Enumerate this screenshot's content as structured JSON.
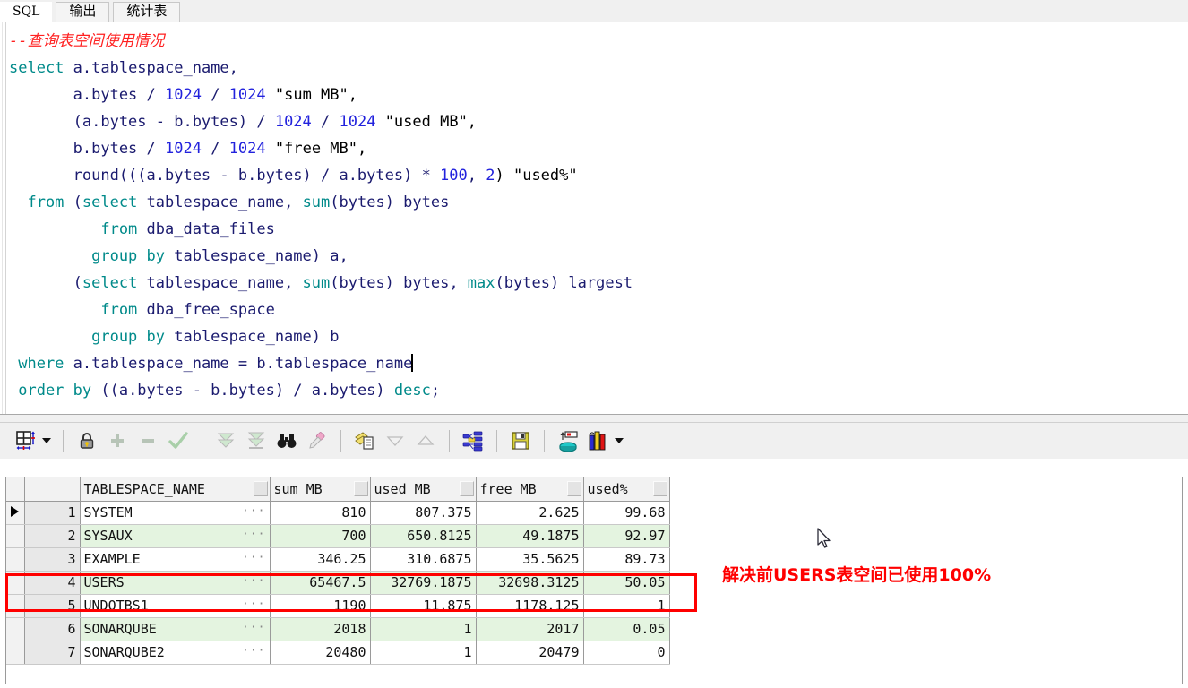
{
  "tabs": [
    {
      "label": "SQL",
      "active": true
    },
    {
      "label": "输出",
      "active": false
    },
    {
      "label": "统计表",
      "active": false
    }
  ],
  "editor": {
    "comment": "--查询表空间使用情况",
    "lines": [
      "select a.tablespace_name,",
      "       a.bytes / 1024 / 1024 \"sum MB\",",
      "       (a.bytes - b.bytes) / 1024 / 1024 \"used MB\",",
      "       b.bytes / 1024 / 1024 \"free MB\",",
      "       round(((a.bytes - b.bytes) / a.bytes) * 100, 2) \"used%\"",
      "  from (select tablespace_name, sum(bytes) bytes",
      "          from dba_data_files",
      "         group by tablespace_name) a,",
      "       (select tablespace_name, sum(bytes) bytes, max(bytes) largest",
      "          from dba_free_space",
      "         group by tablespace_name) b",
      " where a.tablespace_name = b.tablespace_name",
      " order by ((a.bytes - b.bytes) / a.bytes) desc;"
    ],
    "tokens": {
      "l1_kw": "select",
      "l1_rest": " a.tablespace_name,",
      "l2_id": "       a.bytes ",
      "l2_op1": "/ ",
      "l2_n1": "1024",
      "l2_op2": " / ",
      "l2_n2": "1024",
      "l2_str": " \"sum MB\",",
      "l3_a": "       (a.bytes - b.bytes) ",
      "l3_op": "/ ",
      "l3_n1": "1024",
      "l3_mid": " / ",
      "l3_n2": "1024",
      "l3_str": " \"used MB\",",
      "l4_a": "       b.bytes ",
      "l4_op": "/ ",
      "l4_n1": "1024",
      "l4_mid": " / ",
      "l4_n2": "1024",
      "l4_str": " \"free MB\",",
      "l5_a": "       round(((a.bytes - b.bytes) / a.bytes) * ",
      "l5_n1": "100",
      "l5_mid": ", ",
      "l5_n2": "2",
      "l5_str": ") \"used%\"",
      "l6_kw1": "  from ",
      "l6_p": "(",
      "l6_kw2": "select",
      "l6_id": " tablespace_name, ",
      "l6_kw3": "sum",
      "l6_rest": "(bytes) bytes",
      "l7_kw": "          from ",
      "l7_id": "dba_data_files",
      "l8_kw": "         group by ",
      "l8_id": "tablespace_name) a,",
      "l9_p": "       (",
      "l9_kw1": "select",
      "l9_id1": " tablespace_name, ",
      "l9_kw2": "sum",
      "l9_id2": "(bytes) bytes, ",
      "l9_kw3": "max",
      "l9_id3": "(bytes) largest",
      "l10_kw": "          from ",
      "l10_id": "dba_free_space",
      "l11_kw": "         group by ",
      "l11_id": "tablespace_name) b",
      "l12_kw": " where ",
      "l12_id": "a.tablespace_name = b.tablespace_name",
      "l13_kw1": " order by ",
      "l13_id": "((a.bytes - b.bytes) / a.bytes) ",
      "l13_kw2": "desc",
      "l13_end": ";"
    }
  },
  "toolbar": {
    "items": [
      {
        "name": "grid-layout-icon",
        "label": "Grid layout"
      },
      {
        "name": "lock-icon",
        "label": "Lock record"
      },
      {
        "name": "plus-icon",
        "label": "Insert record"
      },
      {
        "name": "minus-icon",
        "label": "Delete record"
      },
      {
        "name": "check-icon",
        "label": "Post edit"
      },
      {
        "name": "fetch-all-icon",
        "label": "Fetch all rows"
      },
      {
        "name": "fetch-last-icon",
        "label": "Fetch last page"
      },
      {
        "name": "binoculars-icon",
        "label": "Find"
      },
      {
        "name": "highlighter-icon",
        "label": "Highlight"
      },
      {
        "name": "copy-icon",
        "label": "Copy to clipboard"
      },
      {
        "name": "triangle-down-icon",
        "label": "Sort descending"
      },
      {
        "name": "triangle-up-icon",
        "label": "Sort ascending"
      },
      {
        "name": "hierarchy-icon",
        "label": "Explain plan"
      },
      {
        "name": "save-icon",
        "label": "Save"
      },
      {
        "name": "export-db-icon",
        "label": "Export data"
      },
      {
        "name": "chart-icon",
        "label": "Chart"
      }
    ]
  },
  "grid": {
    "columns": [
      "TABLESPACE_NAME",
      "sum MB",
      "used MB",
      "free MB",
      "used%"
    ],
    "rows": [
      {
        "n": "1",
        "name": "SYSTEM",
        "sum": "810",
        "used": "807.375",
        "free": "2.625",
        "pct": "99.68",
        "current": true
      },
      {
        "n": "2",
        "name": "SYSAUX",
        "sum": "700",
        "used": "650.8125",
        "free": "49.1875",
        "pct": "92.97",
        "current": false
      },
      {
        "n": "3",
        "name": "EXAMPLE",
        "sum": "346.25",
        "used": "310.6875",
        "free": "35.5625",
        "pct": "89.73",
        "current": false
      },
      {
        "n": "4",
        "name": "USERS",
        "sum": "65467.5",
        "used": "32769.1875",
        "free": "32698.3125",
        "pct": "50.05",
        "current": false
      },
      {
        "n": "5",
        "name": "UNDOTBS1",
        "sum": "1190",
        "used": "11.875",
        "free": "1178.125",
        "pct": "1",
        "current": false
      },
      {
        "n": "6",
        "name": "SONARQUBE",
        "sum": "2018",
        "used": "1",
        "free": "2017",
        "pct": "0.05",
        "current": false
      },
      {
        "n": "7",
        "name": "SONARQUBE2",
        "sum": "20480",
        "used": "1",
        "free": "20479",
        "pct": "0",
        "current": false
      }
    ],
    "cell_ellipsis": "···"
  },
  "annotation": {
    "text": "解决前USERS表空间已使用100%",
    "color": "#ff0000"
  },
  "colors": {
    "comment": "#ff2020",
    "keyword": "#008a8a",
    "number": "#2222dd",
    "identifier": "#1b1b6f",
    "alt_row": "#e4f4e0",
    "highlight_rect": "#ff0000"
  }
}
